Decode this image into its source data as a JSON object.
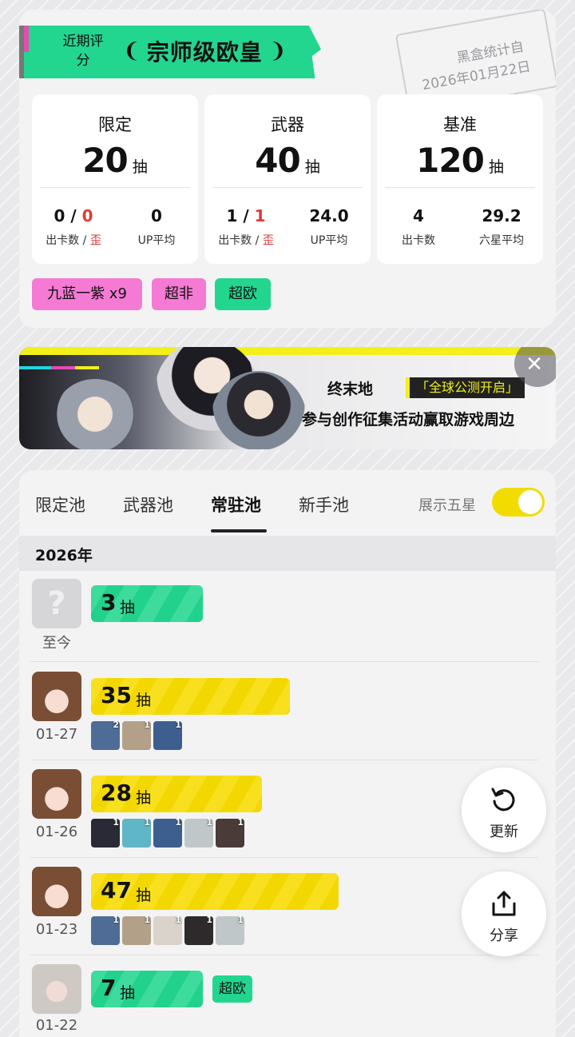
{
  "top_card": {
    "rating_label": "近期评分",
    "rating_title": "宗师级欧皇",
    "laurel_left": "❨",
    "laurel_right": "❩",
    "stamp_line1": "黑盒统计自",
    "stamp_line2": "2026年01月22日",
    "stats": [
      {
        "title": "限定",
        "pulls": "20",
        "unit": "抽",
        "sub1_val_a": "0",
        "sub1_sep": " / ",
        "sub1_val_b": "0",
        "sub1_label_a": "出卡数 / ",
        "sub1_label_b": "歪",
        "sub2_val": "0",
        "sub2_label": "UP平均"
      },
      {
        "title": "武器",
        "pulls": "40",
        "unit": "抽",
        "sub1_val_a": "1",
        "sub1_sep": " / ",
        "sub1_val_b": "1",
        "sub1_label_a": "出卡数 / ",
        "sub1_label_b": "歪",
        "sub2_val": "24.0",
        "sub2_label": "UP平均"
      },
      {
        "title": "基准",
        "pulls": "120",
        "unit": "抽",
        "sub1_val": "4",
        "sub1_label": "出卡数",
        "sub2_val": "29.2",
        "sub2_label": "六星平均"
      }
    ],
    "tags": [
      {
        "label": "九蓝一紫 x9",
        "color": "#f57ad4"
      },
      {
        "label": "超非",
        "color": "#f57ad4"
      },
      {
        "label": "超欧",
        "color": "#22d68f"
      }
    ]
  },
  "ad": {
    "logo": "终末地",
    "badge": "「全球公测开启」",
    "text": "参与创作征集活动赢取游戏周边",
    "close": "✕"
  },
  "pool_tabs": [
    "限定池",
    "武器池",
    "常驻池",
    "新手池"
  ],
  "active_tab": "常驻池",
  "toggle": {
    "label": "展示五星",
    "on": true
  },
  "year": "2026年",
  "records": [
    {
      "date": "至今",
      "pulls": "3",
      "unit": "抽",
      "bar_color": "#22d68f",
      "fill": 0.35,
      "avatar": "unknown",
      "chars": [],
      "tag": ""
    },
    {
      "date": "01-27",
      "pulls": "35",
      "unit": "抽",
      "bar_color": "#f7dc00",
      "fill": 0.62,
      "avatar": "brown-hair-girl",
      "chars": [
        {
          "count": "2",
          "color": "#4f6c96"
        },
        {
          "count": "1",
          "color": "#b3a089"
        },
        {
          "count": "1",
          "color": "#3d5f8f"
        }
      ],
      "tag": ""
    },
    {
      "date": "01-26",
      "pulls": "28",
      "unit": "抽",
      "bar_color": "#f7dc00",
      "fill": 0.54,
      "avatar": "brown-hair-girl",
      "chars": [
        {
          "count": "1",
          "color": "#2a2a36"
        },
        {
          "count": "1",
          "color": "#5fb6c6"
        },
        {
          "count": "1",
          "color": "#3d5f8f"
        },
        {
          "count": "1",
          "color": "#bfc7c9"
        },
        {
          "count": "1",
          "color": "#4a3b38"
        }
      ],
      "tag": ""
    },
    {
      "date": "01-23",
      "pulls": "47",
      "unit": "抽",
      "bar_color": "#f7dc00",
      "fill": 0.78,
      "avatar": "brown-hair-girl",
      "chars": [
        {
          "count": "1",
          "color": "#4f6c96"
        },
        {
          "count": "1",
          "color": "#b3a089"
        },
        {
          "count": "1",
          "color": "#d9d3cc"
        },
        {
          "count": "1",
          "color": "#2e2a2c"
        },
        {
          "count": "1",
          "color": "#bfc7c9"
        }
      ],
      "tag": ""
    },
    {
      "date": "01-22",
      "pulls": "7",
      "unit": "抽",
      "bar_color": "#22d68f",
      "fill": 0.35,
      "avatar": "silver-hair-man",
      "chars": [],
      "tag": "超欧"
    }
  ],
  "fabs": [
    {
      "label": "更新",
      "icon": "refresh-icon"
    },
    {
      "label": "分享",
      "icon": "share-icon"
    }
  ]
}
